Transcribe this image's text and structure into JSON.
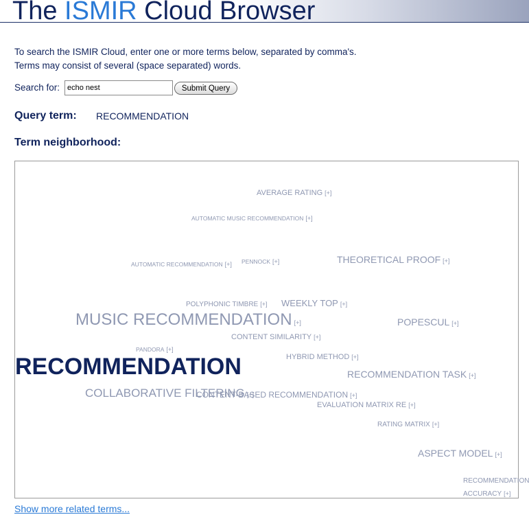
{
  "header": {
    "title_prefix": "The",
    "title_accent": "ISMIR",
    "title_suffix": "Cloud Browser"
  },
  "intro": {
    "line1": "To search the ISMIR Cloud, enter one or more terms below, separated by comma's.",
    "line2": "Terms may consist of several (space separated) words."
  },
  "search": {
    "label": "Search for:",
    "value": "echo nest",
    "submit_label": "Submit Query"
  },
  "query": {
    "label": "Query term:",
    "value": "RECOMMENDATION"
  },
  "neighborhood": {
    "label": "Term neighborhood:",
    "plus_label": "[+]",
    "terms": [
      "AVERAGE RATING",
      "AUTOMATIC MUSIC RECOMMENDATION",
      "AUTOMATIC RECOMMENDATION",
      "PENNOCK",
      "THEORETICAL PROOF",
      "POLYPHONIC TIMBRE",
      "WEEKLY TOP",
      "MUSIC RECOMMENDATION",
      "POPESCUL",
      "CONTENT SIMILARITY",
      "PANDORA",
      "HYBRID METHOD",
      "RECOMMENDATION",
      "RECOMMENDATION TASK",
      "COLLABORATIVE FILTERING",
      "CONTENT-BASED RECOMMENDATION",
      "EVALUATION MATRIX RE",
      "RATING MATRIX",
      "ASPECT MODEL",
      "RECOMMENDATION",
      "ACCURACY"
    ]
  },
  "more_link": "Show more related terms...",
  "colors": {
    "title": "#10235c",
    "accent": "#2a7ad6",
    "term": "#8f98b2",
    "link": "#2a7ad6"
  }
}
